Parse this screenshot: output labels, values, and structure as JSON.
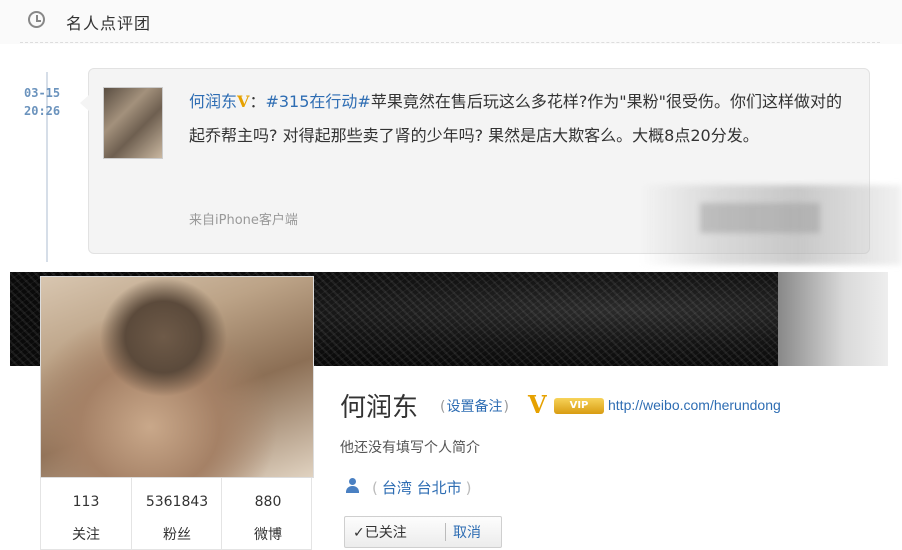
{
  "section": {
    "title": "名人点评团"
  },
  "post": {
    "date": "03-15",
    "time": "20:26",
    "author": "何润东",
    "verified": "V",
    "colon": "：",
    "topic": "#315在行动#",
    "body": "苹果竟然在售后玩这么多花样?作为\"果粉\"很受伤。你们这样做对的起乔帮主吗? 对得起那些卖了肾的少年吗? 果然是店大欺客么。大概8点20分发。",
    "source": "来自iPhone客户端"
  },
  "profile": {
    "name": "何润东",
    "set_remark": "设置备注",
    "verified": "V",
    "vip": "VIP",
    "url": "http://weibo.com/herundong",
    "bio": "他还没有填写个人简介",
    "location": "台湾 台北市",
    "stats": [
      {
        "value": "113",
        "label": "关注"
      },
      {
        "value": "5361843",
        "label": "粉丝"
      },
      {
        "value": "880",
        "label": "微博"
      }
    ],
    "follow_label": "✓已关注",
    "cancel_label": "取消"
  },
  "colors": {
    "link": "#2e6db3",
    "verified": "#e6a100",
    "time": "#6b93bd"
  },
  "icons": [
    "clock-icon",
    "person-icon",
    "check-icon"
  ]
}
